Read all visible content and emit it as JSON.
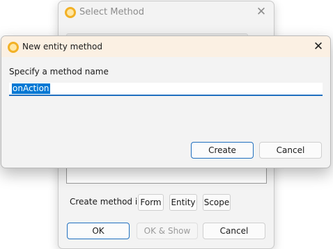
{
  "select_dialog": {
    "title": "Select Method",
    "close_glyph": "✕",
    "create_in_label": "Create method in",
    "targets": {
      "form": "Form",
      "entity": "Entity",
      "scope": "Scope"
    },
    "ok_label": "OK",
    "ok_show_label": "OK & Show",
    "cancel_label": "Cancel"
  },
  "new_method_dialog": {
    "title": "New entity method",
    "close_glyph": "✕",
    "prompt": "Specify a method name",
    "method_name": "onAction",
    "create_label": "Create",
    "cancel_label": "Cancel"
  },
  "colors": {
    "accent": "#1f6fbf",
    "selection": "#0078d4",
    "titlebar_tint": "#fbf0e3",
    "app_icon": "#f2b126"
  },
  "icons": {
    "app": "app-ring-icon",
    "close": "close-icon"
  }
}
